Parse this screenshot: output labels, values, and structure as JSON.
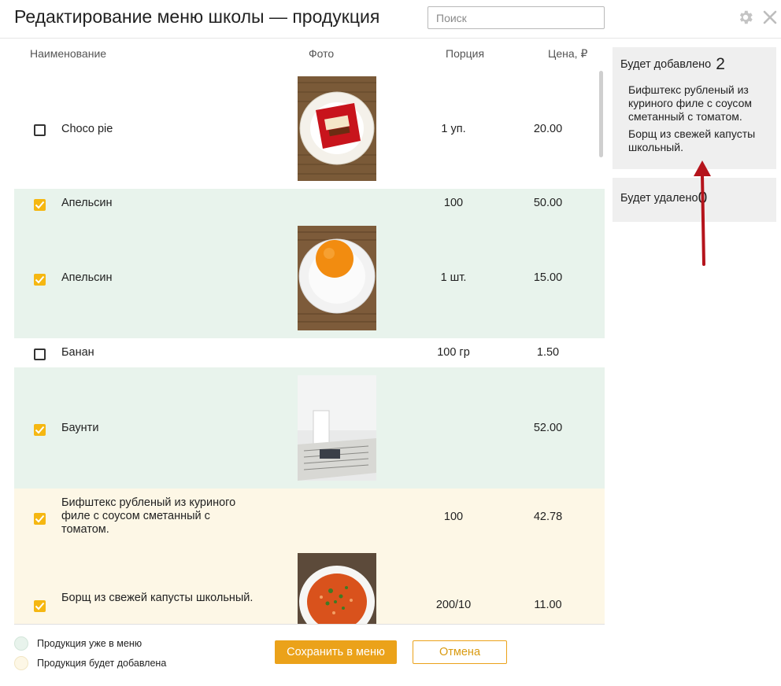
{
  "header": {
    "title": "Редактирование меню школы — продукция",
    "search_placeholder": "Поиск"
  },
  "icons": {
    "settings": "gear-icon",
    "close": "close-icon"
  },
  "columns": {
    "name": "Наименование",
    "photo": "Фото",
    "portion": "Порция",
    "price": "Цена, ₽"
  },
  "rows": [
    {
      "name": "Choco pie",
      "portion": "1 уп.",
      "price": "20.00",
      "checked": false,
      "status": "none",
      "photo": "choco-pie"
    },
    {
      "name": "Апельсин",
      "portion": "100",
      "price": "50.00",
      "checked": true,
      "status": "in-menu",
      "photo": ""
    },
    {
      "name": "Апельсин",
      "portion": "1 шт.",
      "price": "15.00",
      "checked": true,
      "status": "in-menu",
      "photo": "orange"
    },
    {
      "name": "Банан",
      "portion": "100 гр",
      "price": "1.50",
      "checked": false,
      "status": "none",
      "photo": ""
    },
    {
      "name": "Баунти",
      "portion": "",
      "price": "52.00",
      "checked": true,
      "status": "in-menu",
      "photo": "cup-newspaper"
    },
    {
      "name": "Бифштекс рубленый из куриного филе с соусом сметанный с томатом.",
      "portion": "100",
      "price": "42.78",
      "checked": true,
      "status": "to-add",
      "photo": ""
    },
    {
      "name": "Борщ из свежей капусты школьный.",
      "portion": "200/10",
      "price": "11.00",
      "checked": true,
      "status": "to-add",
      "photo": "borscht"
    }
  ],
  "summary": {
    "added": {
      "label": "Будет добавлено",
      "count": "2",
      "items": [
        "Бифштекс рубленый из куриного филе с соусом сметанный с томатом.",
        "Борщ из свежей капусты школьный."
      ]
    },
    "removed": {
      "label": "Будет удалено",
      "count": "0"
    }
  },
  "legend": {
    "in_menu": "Продукция уже в меню",
    "to_add": "Продукция будет добавлена"
  },
  "buttons": {
    "save": "Сохранить в меню",
    "cancel": "Отмена"
  },
  "colors": {
    "in_menu_bg": "#e8f3ec",
    "to_add_bg": "#fdf7e6",
    "accent": "#eba21a",
    "checkbox": "#f5b712",
    "annotation_arrow": "#b5141c"
  }
}
